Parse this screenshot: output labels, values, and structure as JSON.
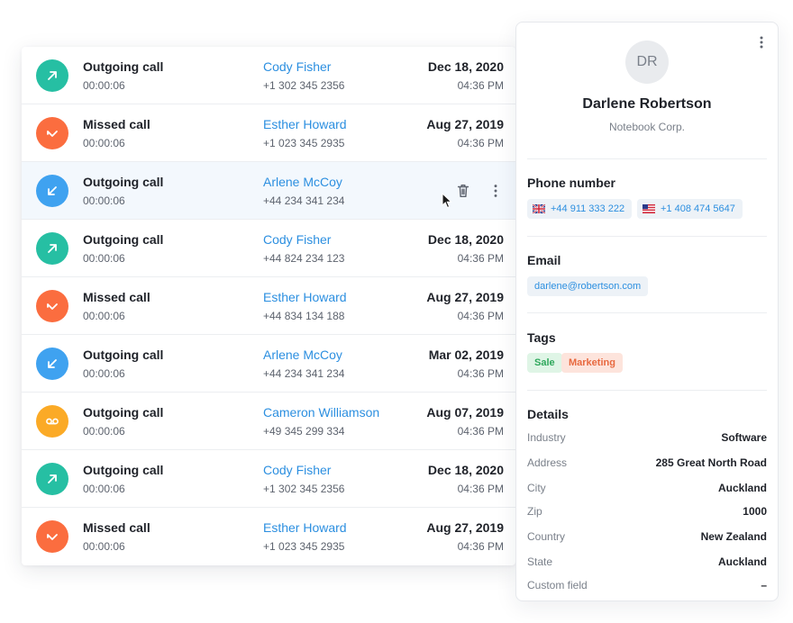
{
  "calls": [
    {
      "kind": "outgoing",
      "icon": "arrow-up-right-icon",
      "color": "#26bfa3",
      "type_label": "Outgoing call",
      "duration": "00:00:06",
      "name": "Cody Fisher",
      "phone": "+1 302 345 2356",
      "date": "Dec 18, 2020",
      "time": "04:36 PM"
    },
    {
      "kind": "missed",
      "icon": "missed-call-icon",
      "color": "#fb6d3f",
      "type_label": "Missed call",
      "duration": "00:00:06",
      "name": "Esther Howard",
      "phone": "+1 023 345 2935",
      "date": "Aug 27, 2019",
      "time": "04:36 PM"
    },
    {
      "kind": "incoming",
      "icon": "arrow-down-left-icon",
      "color": "#3fa2f0",
      "type_label": "Outgoing call",
      "duration": "00:00:06",
      "name": "Arlene McCoy",
      "phone": "+44 234 341 234",
      "date": "",
      "time": "",
      "selected": true
    },
    {
      "kind": "outgoing",
      "icon": "arrow-up-right-icon",
      "color": "#26bfa3",
      "type_label": "Outgoing call",
      "duration": "00:00:06",
      "name": "Cody Fisher",
      "phone": "+44 824 234 123",
      "date": "Dec 18, 2020",
      "time": "04:36 PM"
    },
    {
      "kind": "missed",
      "icon": "missed-call-icon",
      "color": "#fb6d3f",
      "type_label": "Missed call",
      "duration": "00:00:06",
      "name": "Esther Howard",
      "phone": "+44 834 134 188",
      "date": "Aug 27, 2019",
      "time": "04:36 PM"
    },
    {
      "kind": "incoming",
      "icon": "arrow-down-left-icon",
      "color": "#3fa2f0",
      "type_label": "Outgoing call",
      "duration": "00:00:06",
      "name": "Arlene McCoy",
      "phone": "+44 234 341 234",
      "date": "Mar 02, 2019",
      "time": "04:36 PM"
    },
    {
      "kind": "voicemail",
      "icon": "voicemail-icon",
      "color": "#fbaa26",
      "type_label": "Outgoing call",
      "duration": "00:00:06",
      "name": "Cameron Williamson",
      "phone": "+49 345 299 334",
      "date": "Aug 07, 2019",
      "time": "04:36 PM"
    },
    {
      "kind": "outgoing",
      "icon": "arrow-up-right-icon",
      "color": "#26bfa3",
      "type_label": "Outgoing call",
      "duration": "00:00:06",
      "name": "Cody Fisher",
      "phone": "+1 302 345 2356",
      "date": "Dec 18, 2020",
      "time": "04:36 PM"
    },
    {
      "kind": "missed",
      "icon": "missed-call-icon",
      "color": "#fb6d3f",
      "type_label": "Missed call",
      "duration": "00:00:06",
      "name": "Esther Howard",
      "phone": "+1 023 345 2935",
      "date": "Aug 27, 2019",
      "time": "04:36 PM"
    }
  ],
  "contact": {
    "initials": "DR",
    "name": "Darlene Robertson",
    "company": "Notebook Corp.",
    "phone_section": "Phone number",
    "phones": [
      {
        "flag": "uk-flag-icon",
        "number": "+44 911 333 222"
      },
      {
        "flag": "us-flag-icon",
        "number": "+1 408 474 5647"
      }
    ],
    "email_section": "Email",
    "email": "darlene@robertson.com",
    "tags_section": "Tags",
    "tags": [
      "Sale",
      "Marketing"
    ],
    "details_section": "Details",
    "details": [
      {
        "label": "Industry",
        "value": "Software"
      },
      {
        "label": "Address",
        "value": "285 Great North Road"
      },
      {
        "label": "City",
        "value": "Auckland"
      },
      {
        "label": "Zip",
        "value": "1000"
      },
      {
        "label": "Country",
        "value": "New Zealand"
      },
      {
        "label": "State",
        "value": "Auckland"
      },
      {
        "label": "Custom field",
        "value": "–"
      }
    ]
  },
  "colors": {
    "accent": "#2c8fe0",
    "outgoing": "#26bfa3",
    "missed": "#fb6d3f",
    "incoming": "#3fa2f0",
    "voicemail": "#fbaa26",
    "selected_row": "#f3f8fd"
  }
}
